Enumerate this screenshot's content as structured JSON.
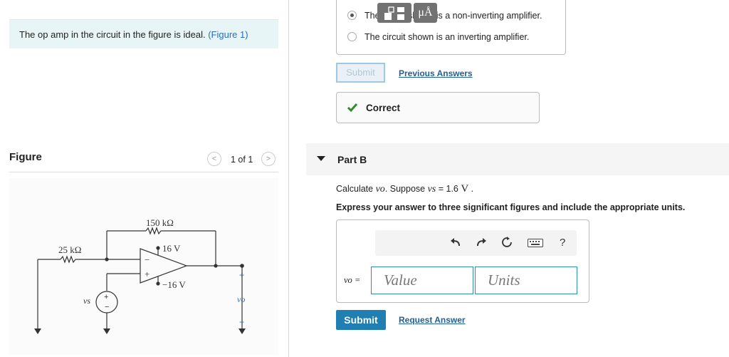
{
  "left": {
    "intro_text": "The op amp in the circuit in the figure is ideal.",
    "intro_link": "(Figure 1)",
    "figure_title": "Figure",
    "pager": {
      "prev": "<",
      "count": "1 of 1",
      "next": ">"
    },
    "circuit": {
      "r_feedback": "150 kΩ",
      "r_input": "25 kΩ",
      "vpos": "16 V",
      "vneg": "−16 V",
      "vs": "vs",
      "vo": "vo",
      "minus_sign": "−",
      "plus_sign": "+"
    }
  },
  "part_a": {
    "options": [
      {
        "label": "The circuit shown is a non-inverting amplifier.",
        "selected": true
      },
      {
        "label": "The circuit shown is an inverting amplifier.",
        "selected": false
      }
    ],
    "submit_label": "Submit",
    "previous_answers": "Previous Answers",
    "result": "Correct",
    "result_color": "#2e8b2e"
  },
  "part_b": {
    "title": "Part B",
    "prompt_prefix": "Calculate ",
    "prompt_vo": "vo",
    "prompt_mid": ". Suppose ",
    "prompt_vs": "vs",
    "prompt_value": " = 1.6 ",
    "prompt_unit": "V",
    "prompt_end": " .",
    "instruction": "Express your answer to three significant figures and include the appropriate units.",
    "toolbar": {
      "templates_icon": "templates-icon",
      "units_label": "μÅ",
      "undo_icon": "undo-icon",
      "redo_icon": "redo-icon",
      "reset_icon": "reset-icon",
      "keyboard_icon": "keyboard-icon",
      "help": "?"
    },
    "answer_label": "vo =",
    "value_placeholder": "Value",
    "units_placeholder": "Units",
    "submit_label": "Submit",
    "request_answer": "Request Answer",
    "accent": "#1f7fb3"
  }
}
